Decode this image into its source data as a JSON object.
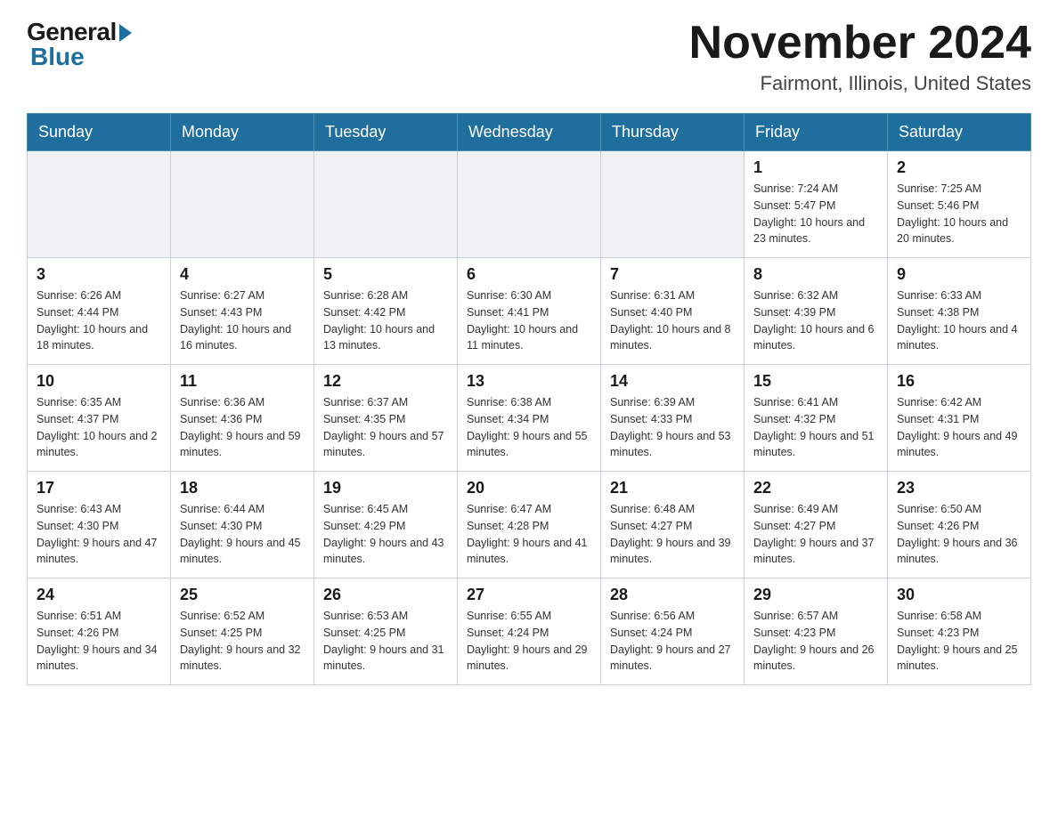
{
  "logo": {
    "general": "General",
    "blue": "Blue"
  },
  "header": {
    "month_title": "November 2024",
    "location": "Fairmont, Illinois, United States"
  },
  "weekdays": [
    "Sunday",
    "Monday",
    "Tuesday",
    "Wednesday",
    "Thursday",
    "Friday",
    "Saturday"
  ],
  "weeks": [
    [
      {
        "day": "",
        "info": ""
      },
      {
        "day": "",
        "info": ""
      },
      {
        "day": "",
        "info": ""
      },
      {
        "day": "",
        "info": ""
      },
      {
        "day": "",
        "info": ""
      },
      {
        "day": "1",
        "info": "Sunrise: 7:24 AM\nSunset: 5:47 PM\nDaylight: 10 hours and 23 minutes."
      },
      {
        "day": "2",
        "info": "Sunrise: 7:25 AM\nSunset: 5:46 PM\nDaylight: 10 hours and 20 minutes."
      }
    ],
    [
      {
        "day": "3",
        "info": "Sunrise: 6:26 AM\nSunset: 4:44 PM\nDaylight: 10 hours and 18 minutes."
      },
      {
        "day": "4",
        "info": "Sunrise: 6:27 AM\nSunset: 4:43 PM\nDaylight: 10 hours and 16 minutes."
      },
      {
        "day": "5",
        "info": "Sunrise: 6:28 AM\nSunset: 4:42 PM\nDaylight: 10 hours and 13 minutes."
      },
      {
        "day": "6",
        "info": "Sunrise: 6:30 AM\nSunset: 4:41 PM\nDaylight: 10 hours and 11 minutes."
      },
      {
        "day": "7",
        "info": "Sunrise: 6:31 AM\nSunset: 4:40 PM\nDaylight: 10 hours and 8 minutes."
      },
      {
        "day": "8",
        "info": "Sunrise: 6:32 AM\nSunset: 4:39 PM\nDaylight: 10 hours and 6 minutes."
      },
      {
        "day": "9",
        "info": "Sunrise: 6:33 AM\nSunset: 4:38 PM\nDaylight: 10 hours and 4 minutes."
      }
    ],
    [
      {
        "day": "10",
        "info": "Sunrise: 6:35 AM\nSunset: 4:37 PM\nDaylight: 10 hours and 2 minutes."
      },
      {
        "day": "11",
        "info": "Sunrise: 6:36 AM\nSunset: 4:36 PM\nDaylight: 9 hours and 59 minutes."
      },
      {
        "day": "12",
        "info": "Sunrise: 6:37 AM\nSunset: 4:35 PM\nDaylight: 9 hours and 57 minutes."
      },
      {
        "day": "13",
        "info": "Sunrise: 6:38 AM\nSunset: 4:34 PM\nDaylight: 9 hours and 55 minutes."
      },
      {
        "day": "14",
        "info": "Sunrise: 6:39 AM\nSunset: 4:33 PM\nDaylight: 9 hours and 53 minutes."
      },
      {
        "day": "15",
        "info": "Sunrise: 6:41 AM\nSunset: 4:32 PM\nDaylight: 9 hours and 51 minutes."
      },
      {
        "day": "16",
        "info": "Sunrise: 6:42 AM\nSunset: 4:31 PM\nDaylight: 9 hours and 49 minutes."
      }
    ],
    [
      {
        "day": "17",
        "info": "Sunrise: 6:43 AM\nSunset: 4:30 PM\nDaylight: 9 hours and 47 minutes."
      },
      {
        "day": "18",
        "info": "Sunrise: 6:44 AM\nSunset: 4:30 PM\nDaylight: 9 hours and 45 minutes."
      },
      {
        "day": "19",
        "info": "Sunrise: 6:45 AM\nSunset: 4:29 PM\nDaylight: 9 hours and 43 minutes."
      },
      {
        "day": "20",
        "info": "Sunrise: 6:47 AM\nSunset: 4:28 PM\nDaylight: 9 hours and 41 minutes."
      },
      {
        "day": "21",
        "info": "Sunrise: 6:48 AM\nSunset: 4:27 PM\nDaylight: 9 hours and 39 minutes."
      },
      {
        "day": "22",
        "info": "Sunrise: 6:49 AM\nSunset: 4:27 PM\nDaylight: 9 hours and 37 minutes."
      },
      {
        "day": "23",
        "info": "Sunrise: 6:50 AM\nSunset: 4:26 PM\nDaylight: 9 hours and 36 minutes."
      }
    ],
    [
      {
        "day": "24",
        "info": "Sunrise: 6:51 AM\nSunset: 4:26 PM\nDaylight: 9 hours and 34 minutes."
      },
      {
        "day": "25",
        "info": "Sunrise: 6:52 AM\nSunset: 4:25 PM\nDaylight: 9 hours and 32 minutes."
      },
      {
        "day": "26",
        "info": "Sunrise: 6:53 AM\nSunset: 4:25 PM\nDaylight: 9 hours and 31 minutes."
      },
      {
        "day": "27",
        "info": "Sunrise: 6:55 AM\nSunset: 4:24 PM\nDaylight: 9 hours and 29 minutes."
      },
      {
        "day": "28",
        "info": "Sunrise: 6:56 AM\nSunset: 4:24 PM\nDaylight: 9 hours and 27 minutes."
      },
      {
        "day": "29",
        "info": "Sunrise: 6:57 AM\nSunset: 4:23 PM\nDaylight: 9 hours and 26 minutes."
      },
      {
        "day": "30",
        "info": "Sunrise: 6:58 AM\nSunset: 4:23 PM\nDaylight: 9 hours and 25 minutes."
      }
    ]
  ]
}
